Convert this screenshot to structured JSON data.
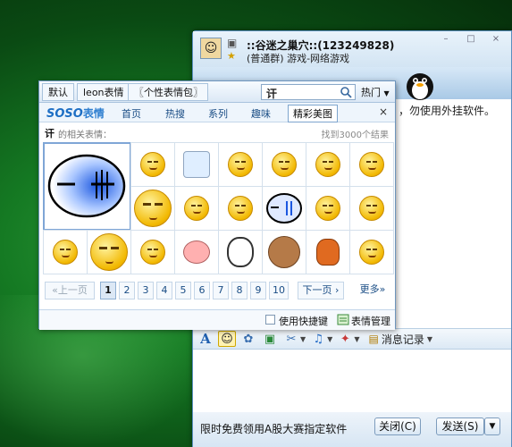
{
  "chat": {
    "title": "::谷迷之巢穴::(123249828)",
    "subtitle": "(普通群) 游戏-网络游戏",
    "notice": "，勿使用外挂软件。",
    "history_label": "消息记录",
    "ad_text": "限时免费领用A股大赛指定软件",
    "close_label": "关闭(C)",
    "send_label": "发送(S)",
    "window_buttons": [
      "–",
      "□",
      "×"
    ]
  },
  "popup": {
    "tabs": [
      "默认",
      "leon表情",
      "〖个性表情包〗"
    ],
    "search_value": "讦",
    "hot_label": "热门",
    "logo_soso": "SOSO",
    "logo_bq": "表情",
    "nav": [
      "首页",
      "热搜",
      "系列",
      "趣味",
      "精彩美图"
    ],
    "active_nav_index": 4,
    "close_symbol": "×",
    "query_word": "讦",
    "query_related": "的相关表情：",
    "found_text": "找到3000个结果",
    "pager": {
      "prev": "«上一页",
      "pages": [
        "1",
        "2",
        "3",
        "4",
        "5",
        "6",
        "7",
        "8",
        "9",
        "10"
      ],
      "current": "1",
      "next": "下一页 ›",
      "more": "更多»"
    },
    "shortcut_label": "使用快捷键",
    "manage_label": "表情管理"
  },
  "icons": {
    "search": "search-icon",
    "close": "close-icon",
    "font": "font-icon",
    "emoticon": "emoticon-icon",
    "history": "history-icon"
  },
  "colors": {
    "desktop_green": "#157a23",
    "window_border": "#5a8fbf",
    "accent_blue": "#1e6fc4"
  }
}
